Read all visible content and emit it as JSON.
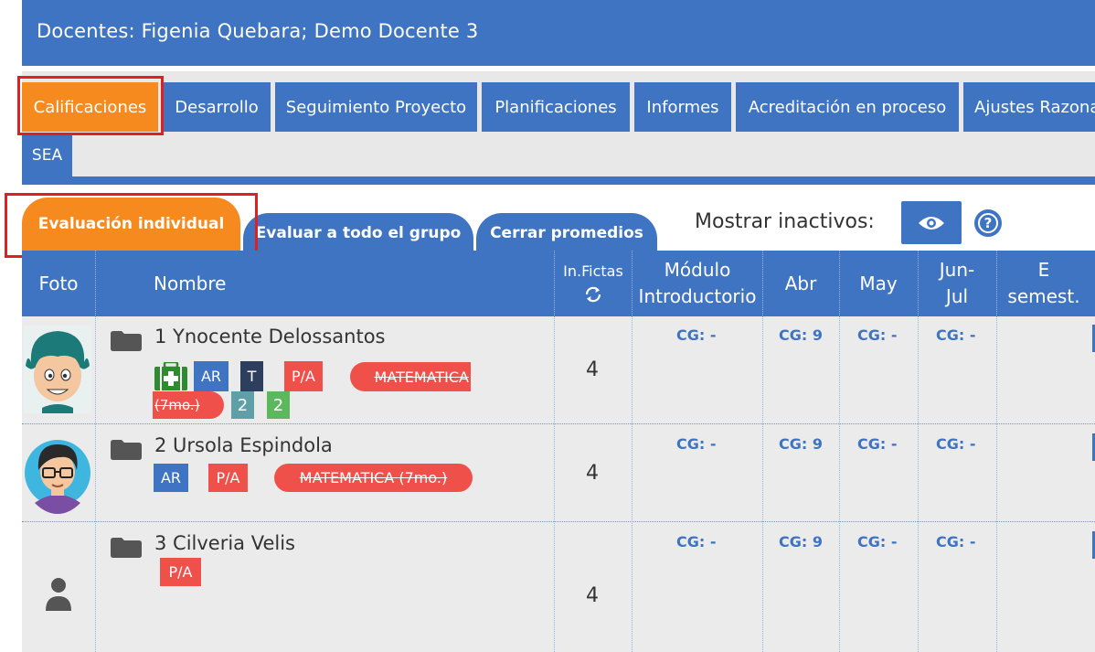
{
  "header": {
    "title": "Docentes: Figenia Quebara; Demo Docente 3"
  },
  "nav": {
    "tabs": [
      {
        "label": "Calificaciones"
      },
      {
        "label": "Desarrollo"
      },
      {
        "label": "Seguimiento Proyecto"
      },
      {
        "label": "Planificaciones"
      },
      {
        "label": "Informes"
      },
      {
        "label": "Acreditación en proceso"
      },
      {
        "label": "Ajustes Razona"
      },
      {
        "label": "SEA"
      }
    ],
    "active_color": "#f78a1e",
    "color": "#3f74c2"
  },
  "subtabs": [
    {
      "label": "Evaluación individual"
    },
    {
      "label": "Evaluar a todo el grupo"
    },
    {
      "label": "Cerrar promedios"
    }
  ],
  "inactive_label": "Mostrar inactivos:",
  "help_label": "?",
  "table": {
    "headers": {
      "foto": "Foto",
      "nombre": "Nombre",
      "fictas": "In.Fictas",
      "modulo1": "Módulo",
      "modulo2": "Introductorio",
      "abr": "Abr",
      "may": "May",
      "jun1": "Jun-",
      "jun2": "Jul",
      "e1": "E",
      "e2": "semest."
    },
    "rows": [
      {
        "name": "1 Ynocente Delossantos",
        "badges": {
          "ar": "AR",
          "t": "T",
          "pa": "P/A",
          "n1": "2",
          "n2": "2"
        },
        "subject1": "MATEMATICA",
        "subject2": "(7mo.)",
        "fictas": "4",
        "cg_mod": "CG: -",
        "cg_abr": "CG: 9",
        "cg_may": "CG: -",
        "cg_jun": "CG: -"
      },
      {
        "name": "2 Ursola Espindola",
        "badges": {
          "ar": "AR",
          "pa": "P/A"
        },
        "subject": "MATEMATICA (7mo.)",
        "fictas": "4",
        "cg_mod": "CG: -",
        "cg_abr": "CG: 9",
        "cg_may": "CG: -",
        "cg_jun": "CG: -"
      },
      {
        "name": "3 Cilveria Velis",
        "badges": {
          "pa": "P/A"
        },
        "fictas": "4",
        "cg_mod": "CG: -",
        "cg_abr": "CG: 9",
        "cg_may": "CG: -",
        "cg_jun": "CG: -"
      }
    ]
  },
  "colors": {
    "primary": "#3f74c2",
    "accent": "#f78a1e",
    "danger": "#f0504a",
    "highlight": "#e02020",
    "teal": "#5fa0a8",
    "green": "#5cb85c",
    "navy": "#2d3e5e"
  },
  "icons": [
    "folder-icon",
    "eye-icon",
    "help-icon",
    "refresh-icon",
    "first-aid-icon",
    "user-icon"
  ]
}
